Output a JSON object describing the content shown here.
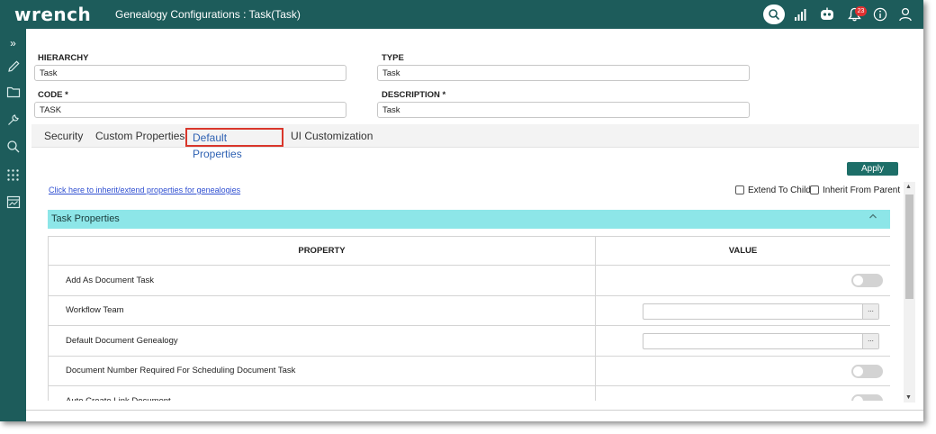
{
  "app": {
    "logo": "wrench",
    "title": "Genealogy Configurations : Task(Task)"
  },
  "topbar": {
    "icons": [
      "search-icon",
      "signal-bars-icon",
      "chatbot-icon",
      "bell-icon",
      "info-icon",
      "user-icon"
    ],
    "notification_count": "23"
  },
  "sidebar": {
    "items": [
      "expand-icon",
      "pencil-icon",
      "folder-icon",
      "wrench-icon",
      "search-icon",
      "apps-grid-icon",
      "dashboard-icon"
    ],
    "expand_glyph": "»"
  },
  "form": {
    "hierarchy": {
      "label": "HIERARCHY",
      "value": "Task"
    },
    "type": {
      "label": "TYPE",
      "value": "Task"
    },
    "code": {
      "label": "CODE *",
      "value": "TASK"
    },
    "description": {
      "label": "DESCRIPTION *",
      "value": "Task"
    }
  },
  "tabs": [
    {
      "label": "Security"
    },
    {
      "label": "Custom Properties"
    },
    {
      "label": "Default Properties",
      "active": true
    },
    {
      "label": "UI Customization"
    }
  ],
  "actions": {
    "apply_label": "Apply"
  },
  "inherit": {
    "link_text": "Click here to inherit/extend properties for genealogies",
    "extend_to_child": "Extend To Child",
    "inherit_from_parent": "Inherit From Parent"
  },
  "section": {
    "title": "Task Properties"
  },
  "table": {
    "headers": {
      "property": "PROPERTY",
      "value": "VALUE"
    },
    "rows": [
      {
        "property": "Add As Document Task",
        "control": "toggle",
        "on": false
      },
      {
        "property": "Workflow Team",
        "control": "lookup",
        "value": ""
      },
      {
        "property": "Default Document Genealogy",
        "control": "lookup",
        "value": ""
      },
      {
        "property": "Document Number Required For Scheduling Document Task",
        "control": "toggle",
        "on": false
      },
      {
        "property": "Auto Create Link Document",
        "control": "toggle",
        "on": false
      }
    ]
  },
  "colors": {
    "brand": "#1d5c5b",
    "section_header": "#8de6e8",
    "active_tab_text": "#2f62b3",
    "highlight": "#d9362b"
  }
}
